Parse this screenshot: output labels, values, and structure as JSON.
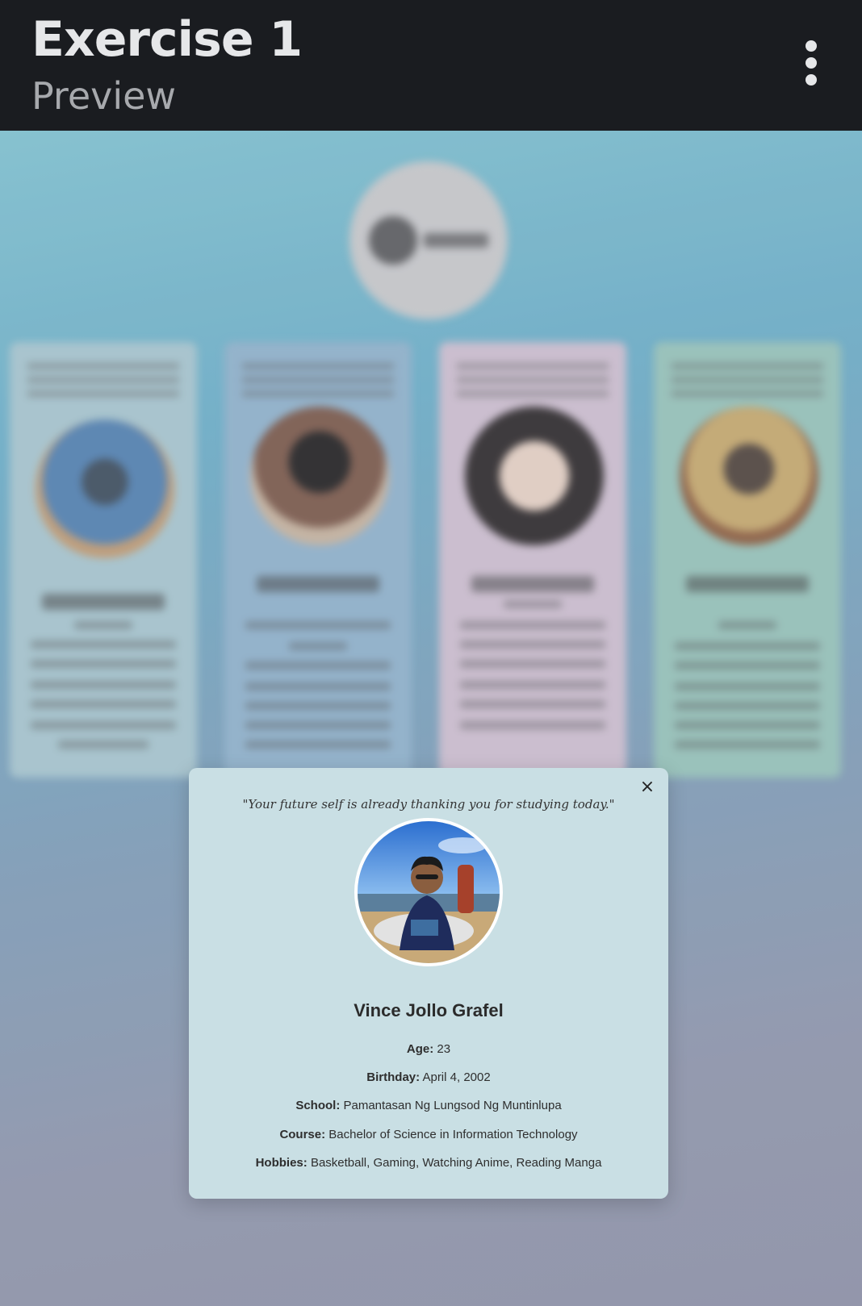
{
  "app": {
    "title": "Exercise 1",
    "subtitle": "Preview",
    "menu_icon": "kebab-vertical-icon"
  },
  "colors": {
    "topbar_bg": "#1a1c20",
    "modal_bg": "#c9dfe4",
    "card_tints": [
      "#a7c6cf",
      "#8fb2cc",
      "#cfbfd0",
      "#96c3b9"
    ]
  },
  "modal": {
    "quote": "\"Your future self is already thanking you for studying today.\"",
    "name": "Vince Jollo Grafel",
    "close_icon": "close-icon",
    "fields": [
      {
        "label": "Age:",
        "value": "23"
      },
      {
        "label": "Birthday:",
        "value": "April 4, 2002"
      },
      {
        "label": "School:",
        "value": "Pamantasan Ng Lungsod Ng Muntinlupa"
      },
      {
        "label": "Course:",
        "value": "Bachelor of Science in Information Technology"
      },
      {
        "label": "Hobbies:",
        "value": "Basketball, Gaming, Watching Anime, Reading Manga"
      }
    ]
  }
}
